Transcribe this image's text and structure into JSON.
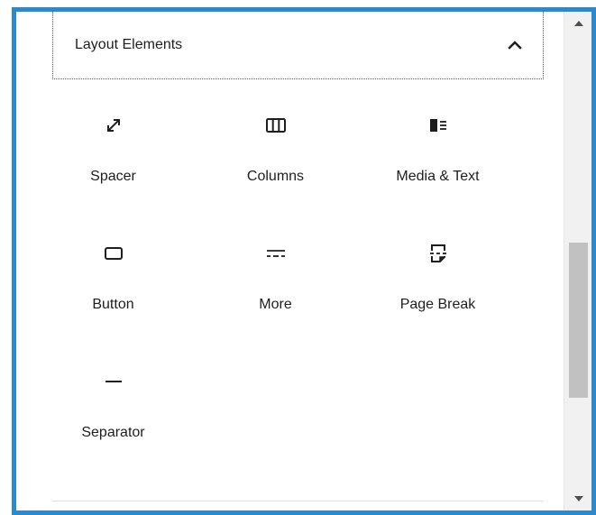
{
  "section": {
    "title": "Layout Elements",
    "expanded": true,
    "toggle_icon": "chevron-up-icon"
  },
  "blocks": [
    {
      "label": "Spacer",
      "icon": "resize-arrows-icon"
    },
    {
      "label": "Columns",
      "icon": "columns-icon"
    },
    {
      "label": "Media & Text",
      "icon": "media-text-icon"
    },
    {
      "label": "Button",
      "icon": "button-icon"
    },
    {
      "label": "More",
      "icon": "more-icon"
    },
    {
      "label": "Page Break",
      "icon": "page-break-icon"
    },
    {
      "label": "Separator",
      "icon": "separator-icon"
    }
  ],
  "colors": {
    "frame_border": "#2a8ad0",
    "text": "#1e1e1e",
    "scrollbar_track": "#f1f1f1",
    "scrollbar_thumb": "#c1c1c1"
  },
  "scrollbar": {
    "up_icon": "scroll-up-arrow-icon",
    "down_icon": "scroll-down-arrow-icon"
  }
}
